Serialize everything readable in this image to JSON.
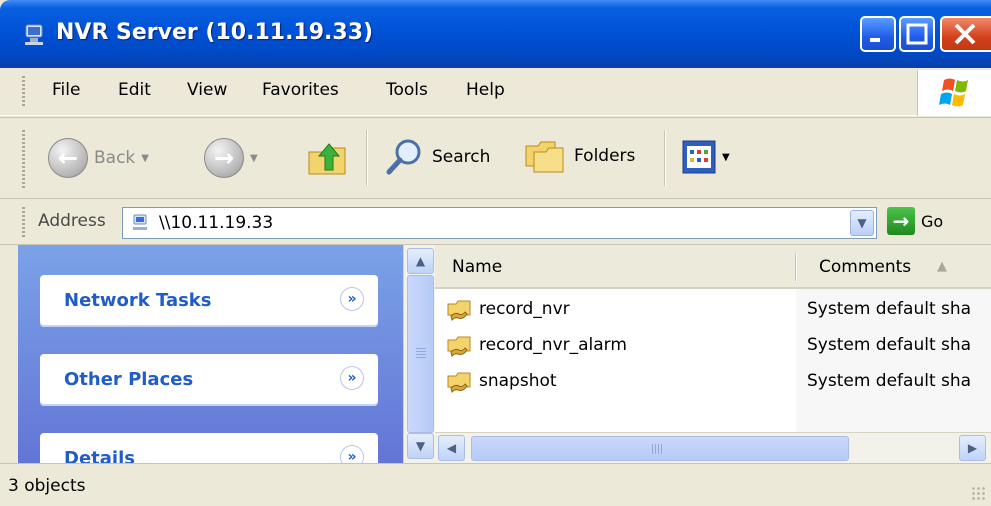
{
  "window": {
    "title": "NVR Server (10.11.19.33)"
  },
  "menu": [
    "File",
    "Edit",
    "View",
    "Favorites",
    "Tools",
    "Help"
  ],
  "toolbar": {
    "back_label": "Back",
    "search_label": "Search",
    "folders_label": "Folders"
  },
  "address": {
    "label": "Address",
    "value": "\\\\10.11.19.33",
    "go_label": "Go"
  },
  "tasks": [
    {
      "title": "Network Tasks"
    },
    {
      "title": "Other Places"
    },
    {
      "title": "Details"
    }
  ],
  "columns": {
    "name": "Name",
    "comments": "Comments"
  },
  "files": [
    {
      "name": "record_nvr",
      "comment": "System default sha"
    },
    {
      "name": "record_nvr_alarm",
      "comment": "System default sha"
    },
    {
      "name": "snapshot",
      "comment": "System default sha"
    }
  ],
  "status": {
    "text": "3 objects"
  },
  "colors": {
    "titlebar": "#0052d6",
    "taskpane": "#6f8ee0",
    "task_title": "#215dc6"
  }
}
